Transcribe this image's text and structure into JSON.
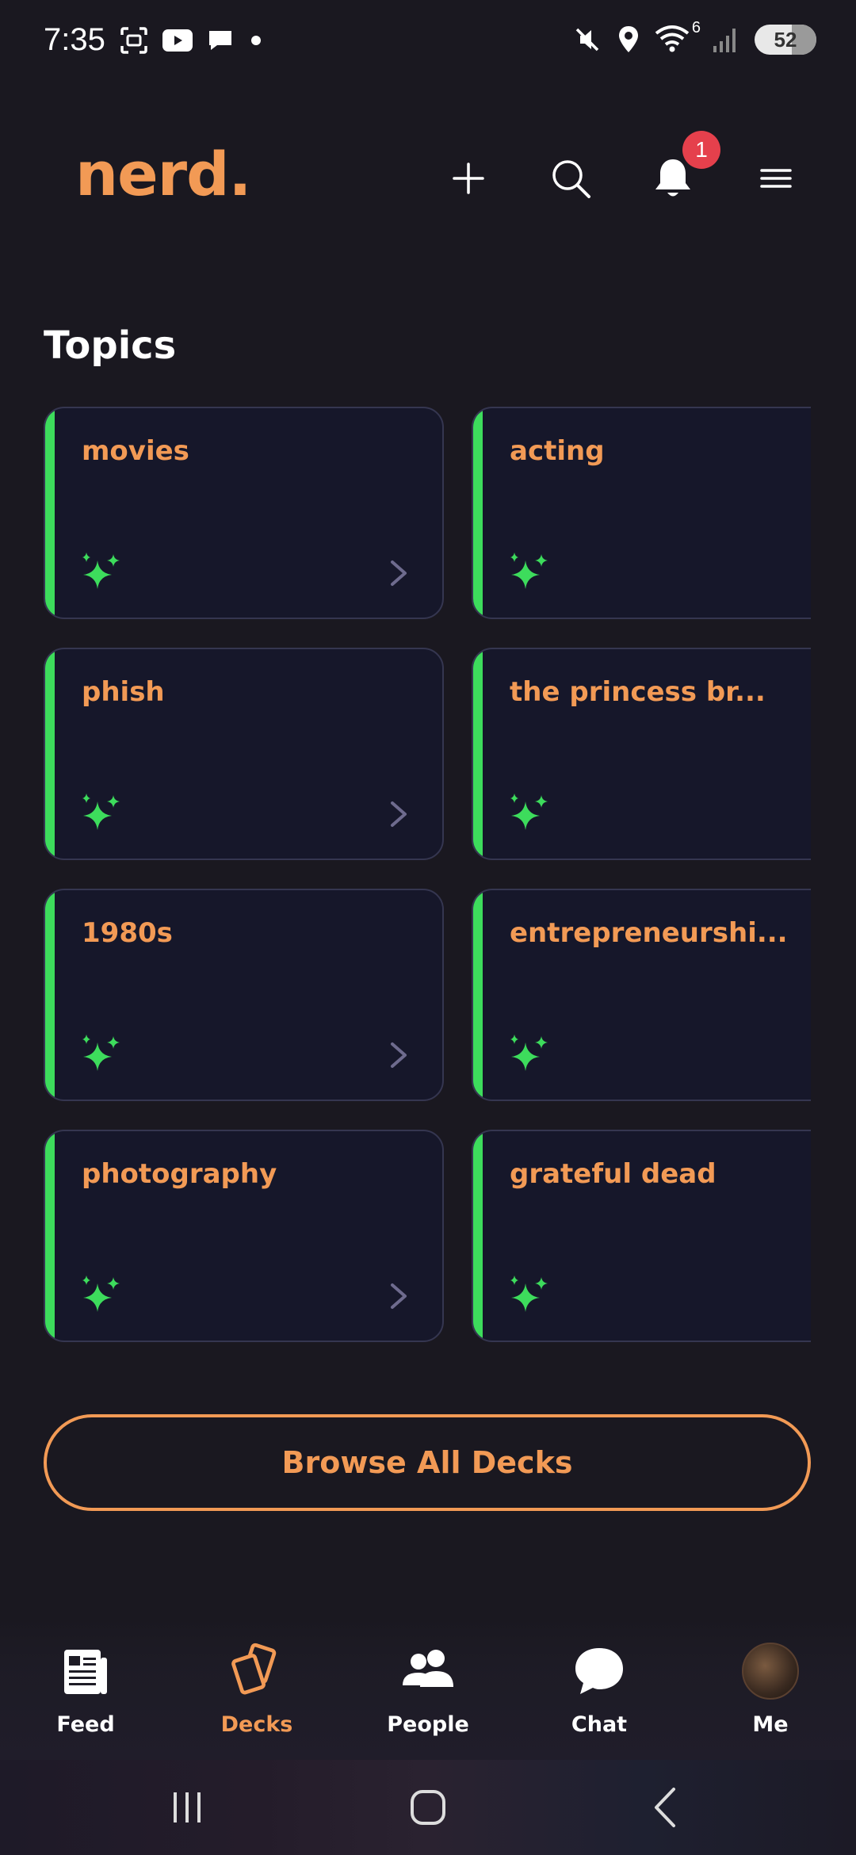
{
  "status_bar": {
    "time": "7:35",
    "battery": "52",
    "wifi_label": "6",
    "left_icons": [
      "screenshot-icon",
      "youtube-icon",
      "chat-bubble-icon",
      "dot-icon"
    ],
    "right_icons": [
      "mute-icon",
      "location-icon",
      "wifi-icon",
      "signal-icon"
    ]
  },
  "header": {
    "logo": "nerd.",
    "notification_count": "1",
    "icons": [
      "plus-icon",
      "search-icon",
      "bell-icon",
      "menu-icon"
    ]
  },
  "topics": {
    "title": "Topics",
    "items": [
      {
        "label": "movies"
      },
      {
        "label": "acting"
      },
      {
        "label": "phish"
      },
      {
        "label": "the princess br..."
      },
      {
        "label": "1980s"
      },
      {
        "label": "entrepreneurshi..."
      },
      {
        "label": "photography"
      },
      {
        "label": "grateful dead"
      }
    ]
  },
  "browse_button": "Browse All Decks",
  "bottom_nav": {
    "items": [
      {
        "label": "Feed",
        "icon": "feed-icon"
      },
      {
        "label": "Decks",
        "icon": "decks-icon",
        "active": true
      },
      {
        "label": "People",
        "icon": "people-icon"
      },
      {
        "label": "Chat",
        "icon": "chat-icon"
      },
      {
        "label": "Me",
        "icon": "avatar"
      }
    ]
  },
  "colors": {
    "background": "#1a1820",
    "accent_orange": "#f29a55",
    "accent_green": "#3ddc5c",
    "card_bg": "#16172a",
    "badge_red": "#e5404c"
  }
}
